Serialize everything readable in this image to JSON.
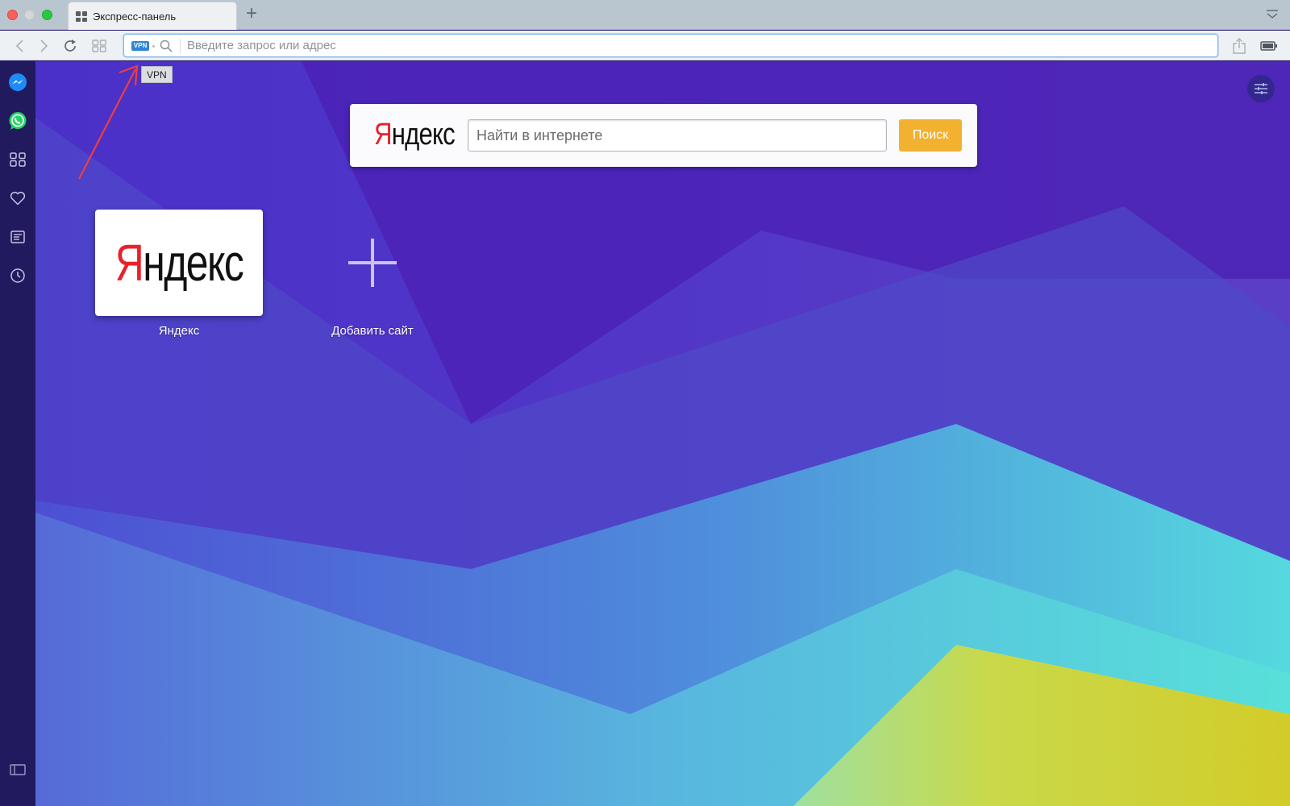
{
  "window": {
    "tab_title": "Экспресс-панель"
  },
  "toolbar": {
    "vpn_badge": "VPN",
    "address_placeholder": "Введите запрос или адрес",
    "address_value": ""
  },
  "tooltip": {
    "vpn": "VPN"
  },
  "sidebar": {
    "items": [
      {
        "icon": "messenger-icon"
      },
      {
        "icon": "whatsapp-icon"
      },
      {
        "icon": "apps-grid-icon"
      },
      {
        "icon": "heart-icon"
      },
      {
        "icon": "news-icon"
      },
      {
        "icon": "history-clock-icon"
      },
      {
        "icon": "sidebar-toggle-icon"
      }
    ]
  },
  "search": {
    "logo": "Яндекс",
    "logo_first_letter": "Я",
    "logo_rest": "ндекс",
    "placeholder": "Найти в интернете",
    "button_label": "Поиск"
  },
  "speed_dial": {
    "tiles": [
      {
        "label": "Яндекс",
        "logo_first_letter": "Я",
        "logo_rest": "ндекс"
      }
    ],
    "add_label": "Добавить сайт"
  },
  "colors": {
    "sidebar": "#221a5e",
    "accent_button": "#f3b130",
    "logo_red": "#e8222a",
    "vpn_badge": "#2f86d3"
  }
}
